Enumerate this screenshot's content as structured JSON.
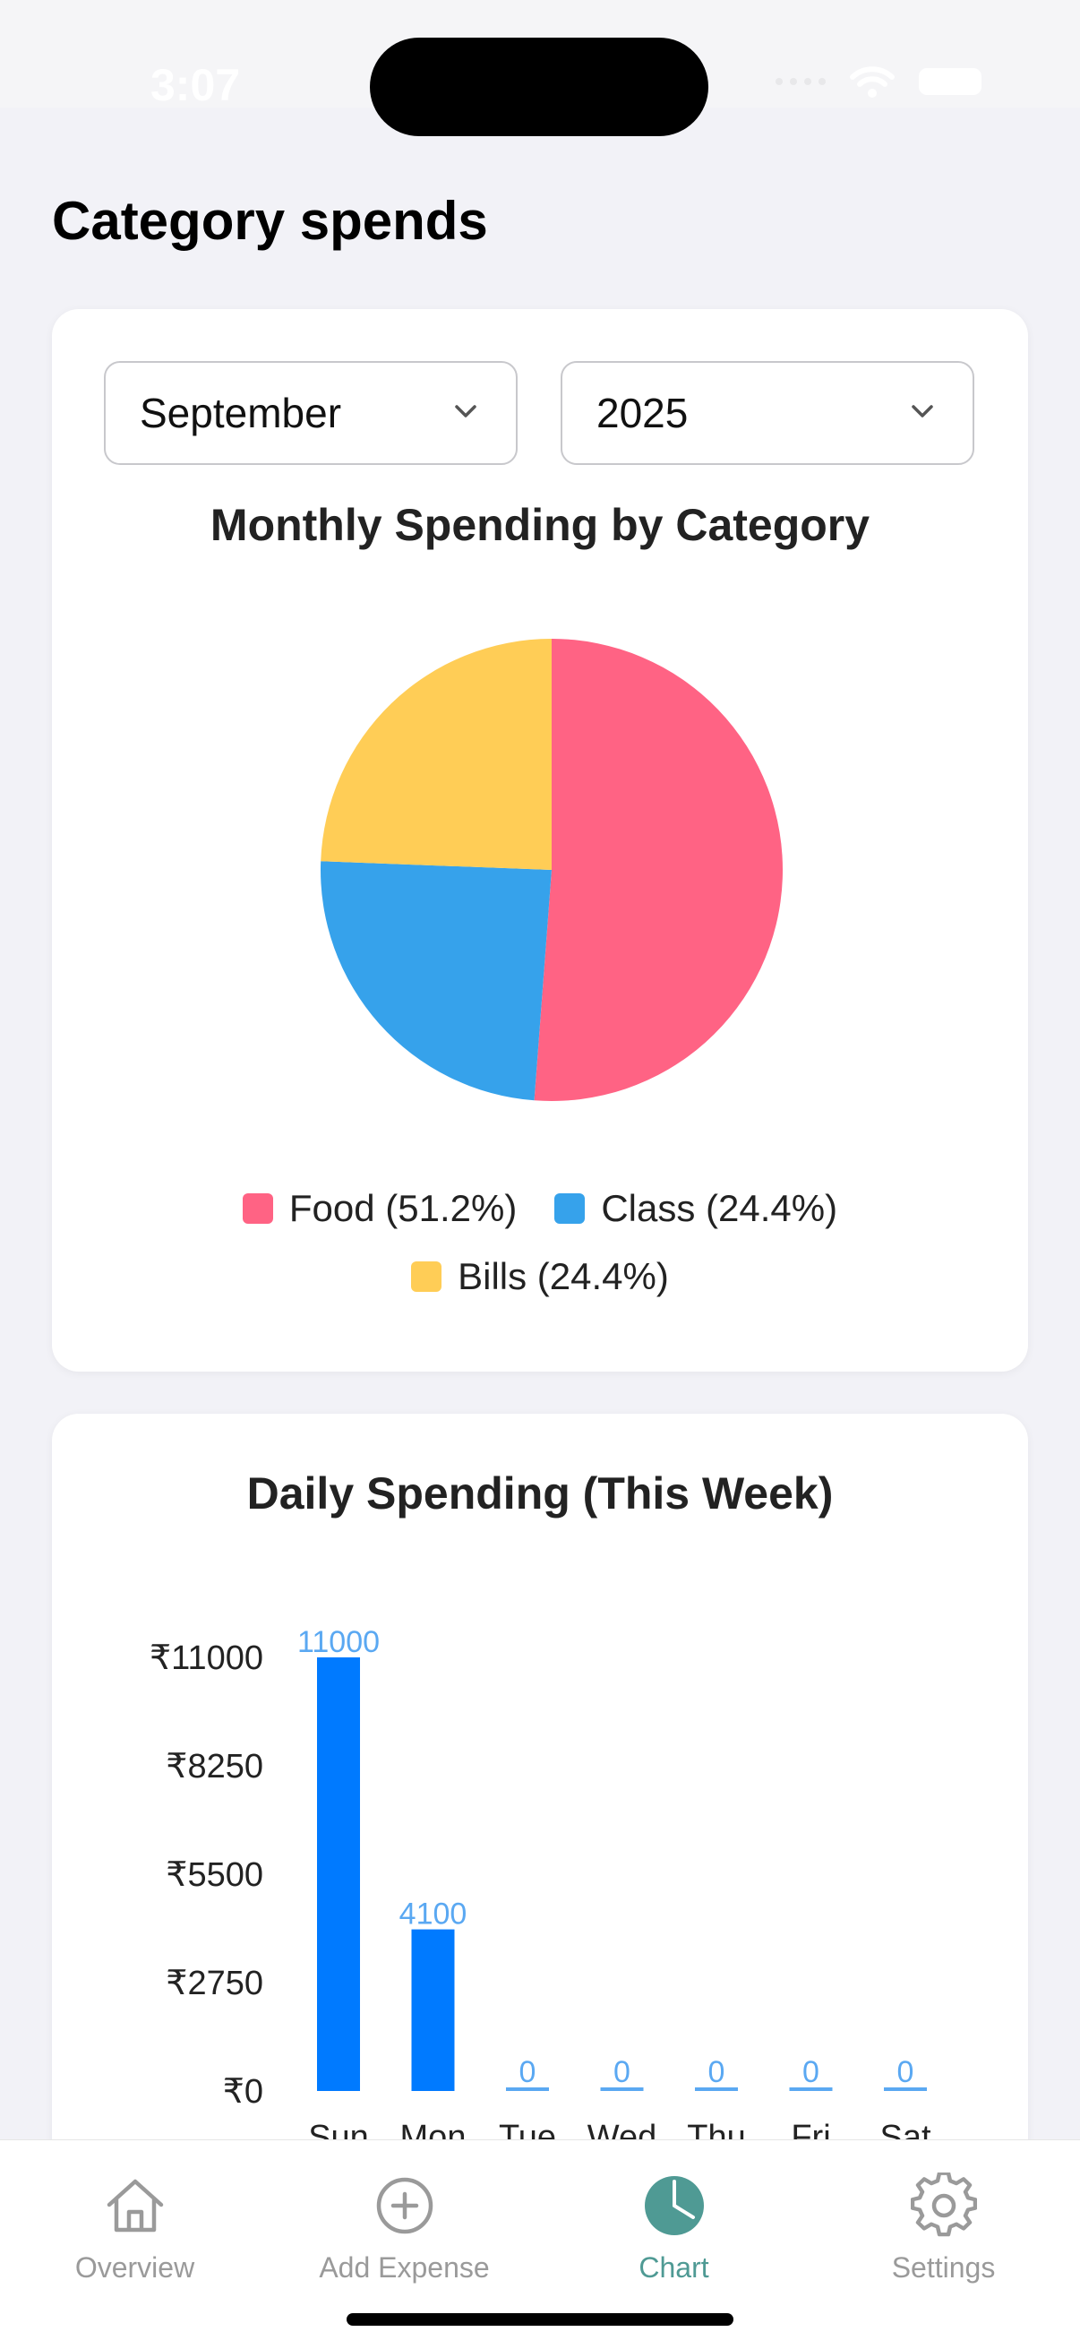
{
  "status": {
    "time": "3:07"
  },
  "page": {
    "title": "Category spends"
  },
  "filters": {
    "month": "September",
    "year": "2025"
  },
  "colors": {
    "food": "#ff6384",
    "class": "#36a2eb",
    "bills": "#ffcd56",
    "bar": "#007aff",
    "accent": "#4f9a94"
  },
  "pie": {
    "title": "Monthly Spending by Category",
    "legend": [
      {
        "label": "Food (51.2%)",
        "color": "#ff6384"
      },
      {
        "label": "Class (24.4%)",
        "color": "#36a2eb"
      },
      {
        "label": "Bills (24.4%)",
        "color": "#ffcd56"
      }
    ]
  },
  "chart_data": [
    {
      "type": "pie",
      "title": "Monthly Spending by Category",
      "categories": [
        "Food",
        "Class",
        "Bills"
      ],
      "values": [
        51.2,
        24.4,
        24.4
      ],
      "legend": "bottom"
    },
    {
      "type": "bar",
      "title": "Daily Spending (This Week)",
      "categories": [
        "Sun",
        "Mon",
        "Tue",
        "Wed",
        "Thu",
        "Fri",
        "Sat"
      ],
      "values": [
        11000,
        4100,
        0,
        0,
        0,
        0,
        0
      ],
      "ylim": [
        0,
        11000
      ],
      "yticks": [
        "₹0",
        "₹2750",
        "₹5500",
        "₹8250",
        "₹11000"
      ],
      "data_labels": [
        "11000",
        "4100",
        "0",
        "0",
        "0",
        "0",
        "0"
      ]
    }
  ],
  "tabs": [
    {
      "label": "Overview",
      "icon": "home-icon"
    },
    {
      "label": "Add Expense",
      "icon": "plus-circle-icon"
    },
    {
      "label": "Chart",
      "icon": "pie-chart-icon"
    },
    {
      "label": "Settings",
      "icon": "gear-icon"
    }
  ]
}
